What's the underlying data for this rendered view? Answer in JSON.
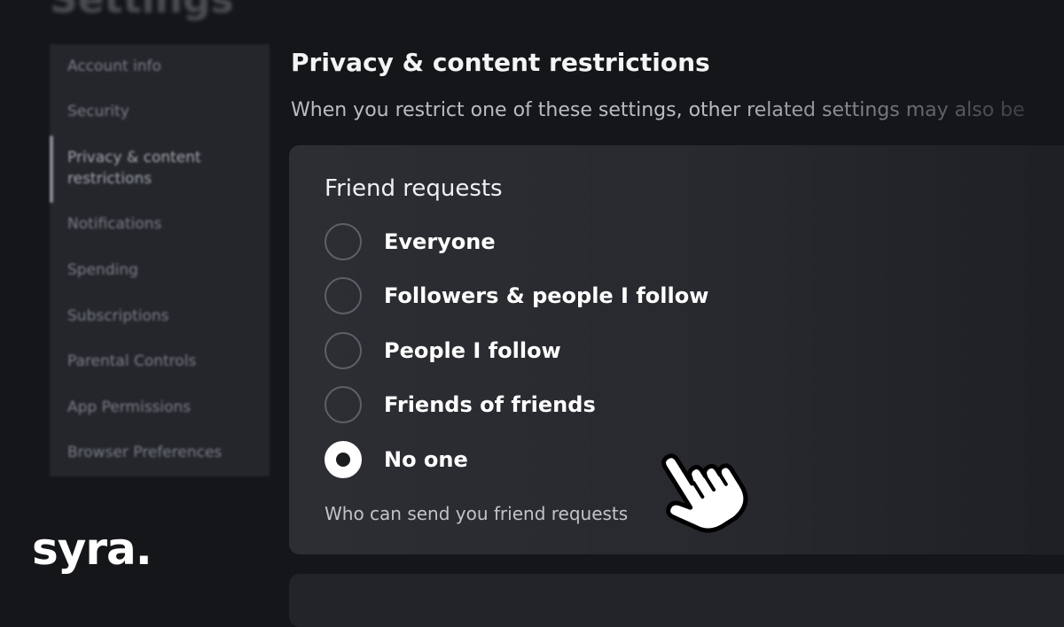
{
  "page": {
    "heading": "Settings"
  },
  "sidebar": {
    "items": [
      {
        "label": "Account info"
      },
      {
        "label": "Security"
      },
      {
        "label": "Privacy & content restrictions",
        "line1": "Privacy & content",
        "line2": "restrictions",
        "active": true
      },
      {
        "label": "Notifications"
      },
      {
        "label": "Spending"
      },
      {
        "label": "Subscriptions"
      },
      {
        "label": "Parental Controls"
      },
      {
        "label": "App Permissions"
      },
      {
        "label": "Browser Preferences"
      }
    ]
  },
  "section": {
    "title": "Privacy & content restrictions",
    "description": "When you restrict one of these settings, other related settings may also be"
  },
  "friend_requests": {
    "title": "Friend requests",
    "options": [
      {
        "label": "Everyone",
        "selected": false
      },
      {
        "label": "Followers & people I follow",
        "selected": false
      },
      {
        "label": "People I follow",
        "selected": false
      },
      {
        "label": "Friends of friends",
        "selected": false
      },
      {
        "label": "No one",
        "selected": true
      }
    ],
    "caption": "Who can send you friend requests"
  },
  "branding": {
    "logo_text": "syra."
  },
  "icons": {
    "cursor": "hand-pointer-icon"
  },
  "colors": {
    "background": "#151619",
    "card": "#2c2e33",
    "sidebar": "#24262b",
    "text": "#ffffff",
    "radio_border": "#5c6067"
  }
}
